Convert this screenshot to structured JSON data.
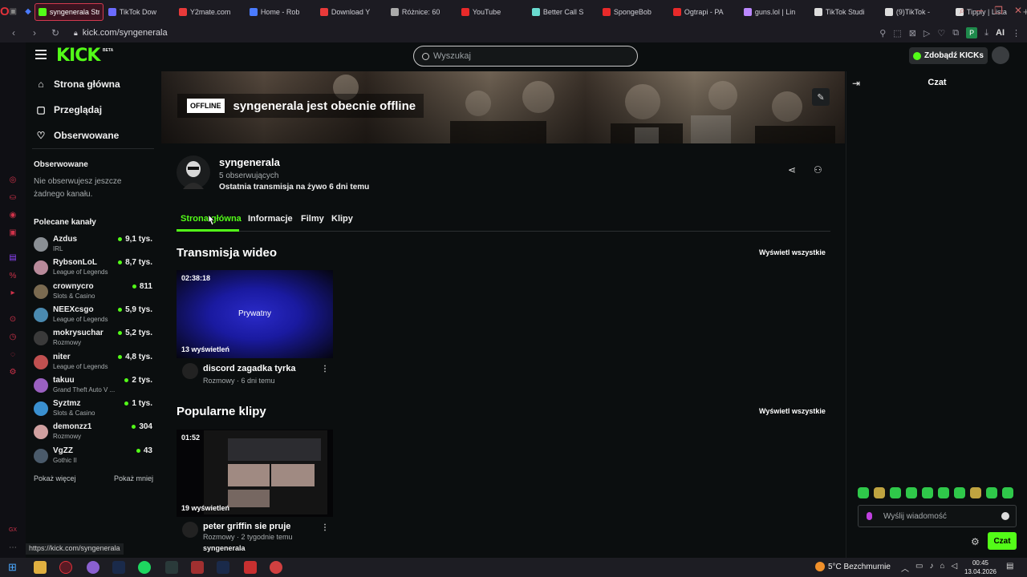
{
  "browser": {
    "tabs": [
      {
        "label": "syngenerala Stream -",
        "color": "#53fc18",
        "active": true
      },
      {
        "label": "TikTok Dow",
        "color": "#6b6bff"
      },
      {
        "label": "Y2mate.com",
        "color": "#e83a3a"
      },
      {
        "label": "Home - Rob",
        "color": "#4a7bff"
      },
      {
        "label": "Download Y",
        "color": "#e83a3a"
      },
      {
        "label": "Różnice: 60",
        "color": "#aaaaaa"
      },
      {
        "label": "YouTube",
        "color": "#e82a2a"
      },
      {
        "label": "Better Call S",
        "color": "#6adbd0"
      },
      {
        "label": "SpongeBob",
        "color": "#e82a2a"
      },
      {
        "label": "Ogtrapi - PA",
        "color": "#e82a2a"
      },
      {
        "label": "guns.lol | Lin",
        "color": "#bb88ff"
      },
      {
        "label": "TikTok Studi",
        "color": "#dddddd"
      },
      {
        "label": "(9)TikTok -",
        "color": "#dddddd"
      },
      {
        "label": "Tipply | Lista",
        "color": "#dddddd"
      }
    ],
    "new_tab": "+",
    "url": "kick.com/syngenerala",
    "profile_letter": "P",
    "ai_label": "AI",
    "status_url": "https://kick.com/syngenerala"
  },
  "header": {
    "logo": "KICK",
    "logo_badge": "BETA",
    "search_placeholder": "Wyszukaj",
    "kicks_button": "Zdobądź KICKs"
  },
  "sidebar": {
    "nav": [
      {
        "icon": "home-icon",
        "glyph": "⌂",
        "label": "Strona główna"
      },
      {
        "icon": "browse-icon",
        "glyph": "▢",
        "label": "Przeglądaj"
      },
      {
        "icon": "heart-icon",
        "glyph": "♡",
        "label": "Obserwowane"
      }
    ],
    "followed_title": "Obserwowane",
    "followed_empty": "Nie obserwujesz jeszcze żadnego kanału.",
    "recommended_title": "Polecane kanały",
    "channels": [
      {
        "name": "Azdus",
        "category": "IRL",
        "viewers": "9,1 tys.",
        "color": "#8a8f94"
      },
      {
        "name": "RybsonLoL",
        "category": "League of Legends",
        "viewers": "8,7 tys.",
        "color": "#b88a9a"
      },
      {
        "name": "crownycro",
        "category": "Slots & Casino",
        "viewers": "811",
        "color": "#7a6a50"
      },
      {
        "name": "NEEXcsgo",
        "category": "League of Legends",
        "viewers": "5,9 tys.",
        "color": "#4a8ab0"
      },
      {
        "name": "mokrysuchar",
        "category": "Rozmowy",
        "viewers": "5,2 tys.",
        "color": "#3a3a3a"
      },
      {
        "name": "niter",
        "category": "League of Legends",
        "viewers": "4,8 tys.",
        "color": "#c05050"
      },
      {
        "name": "takuu",
        "category": "Grand Theft Auto V ...",
        "viewers": "2 tys.",
        "color": "#9a60c0"
      },
      {
        "name": "Syztmz",
        "category": "Slots & Casino",
        "viewers": "1 tys.",
        "color": "#3a90d0"
      },
      {
        "name": "demonzz1",
        "category": "Rozmowy",
        "viewers": "304",
        "color": "#d0a0a0"
      },
      {
        "name": "VgZZ",
        "category": "Gothic II",
        "viewers": "43",
        "color": "#4a5a6a"
      }
    ],
    "show_more": "Pokaż więcej",
    "show_less": "Pokaż mniej"
  },
  "channel": {
    "offline_badge": "OFFLINE",
    "offline_text": "syngenerala jest obecnie offline",
    "name": "syngenerala",
    "followers": "5 obserwujących",
    "last_stream": "Ostatnia transmisja na żywo 6 dni temu",
    "tabs": [
      "Strona główna",
      "Informacje",
      "Filmy",
      "Klipy"
    ]
  },
  "videos": {
    "title": "Transmisja wideo",
    "see_all": "Wyświetl wszystkie",
    "item": {
      "duration": "02:38:18",
      "private": "Prywatny",
      "views": "13 wyświetleń",
      "title": "discord zagadka tyrka",
      "meta": "Rozmowy · 6 dni temu"
    }
  },
  "clips": {
    "title": "Popularne klipy",
    "see_all": "Wyświetl wszystkie",
    "item": {
      "duration": "01:52",
      "views": "19 wyświetleń",
      "title": "peter griffin sie pruje",
      "meta": "Rozmowy · 2 tygodnie temu",
      "author": "syngenerala"
    }
  },
  "chat": {
    "title": "Czat",
    "input_placeholder": "Wyślij wiadomość",
    "send_label": "Czat"
  },
  "taskbar": {
    "weather": "5°C  Bezchmurnie",
    "time": "00:45",
    "date": "13.04.2026"
  }
}
